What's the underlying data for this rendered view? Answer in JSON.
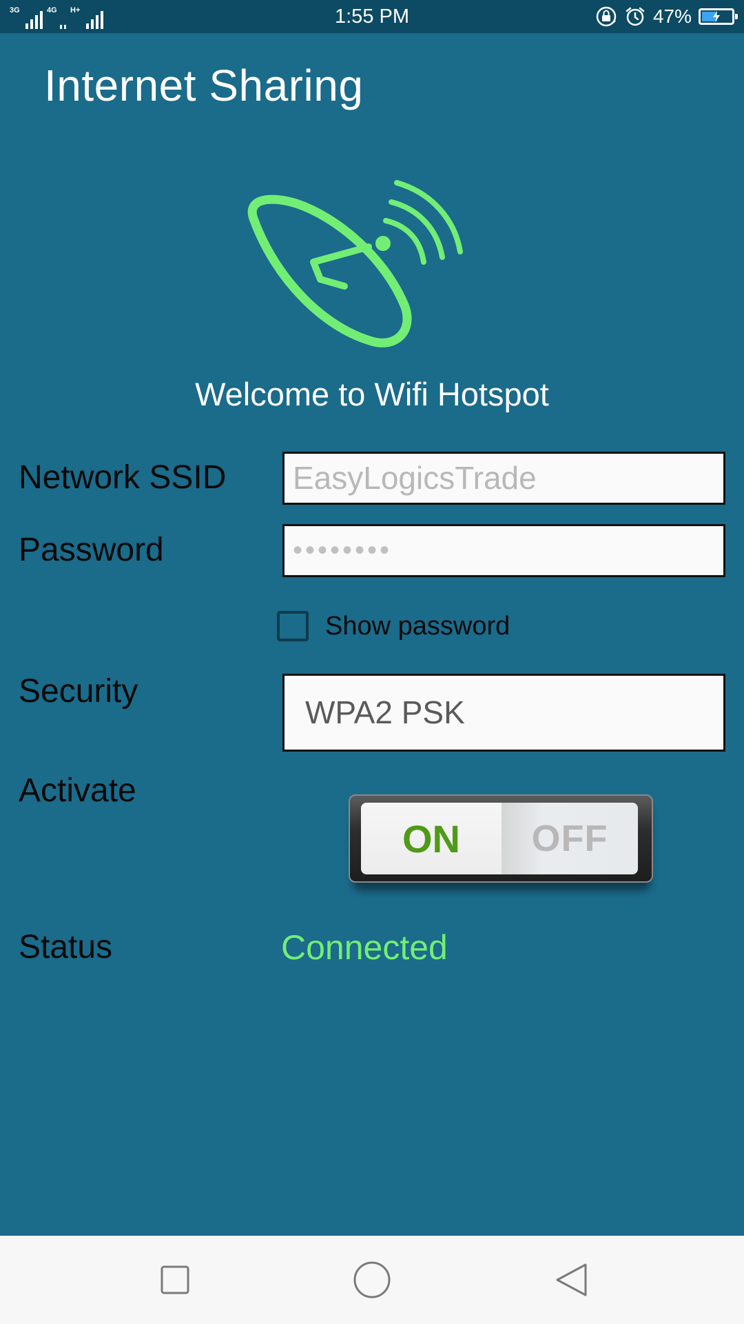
{
  "status_bar": {
    "network_1": "3G",
    "network_2": "4G",
    "network_3": "H+",
    "time": "1:55 PM",
    "battery_percent": "47%",
    "icons": [
      "rotation-lock-icon",
      "alarm-icon",
      "battery-charging-icon"
    ]
  },
  "app": {
    "title": "Internet Sharing",
    "logo_icon": "satellite-dish-icon",
    "welcome": "Welcome to Wifi Hotspot"
  },
  "form": {
    "ssid_label": "Network SSID",
    "ssid_placeholder": "EasyLogicsTrade",
    "password_label": "Password",
    "password_value": "••••••••",
    "show_password_label": "Show password",
    "show_password_checked": false,
    "security_label": "Security",
    "security_value": "WPA2 PSK",
    "activate_label": "Activate",
    "toggle_on_label": "ON",
    "toggle_off_label": "OFF",
    "toggle_state": "on",
    "status_label": "Status",
    "status_value": "Connected"
  },
  "nav": {
    "icons": [
      "recents-square-icon",
      "home-circle-icon",
      "back-triangle-icon"
    ]
  },
  "colors": {
    "background": "#1b6b8b",
    "status_bar": "#0d4a63",
    "accent_green": "#73ee75",
    "toggle_on_text": "#4f9a18"
  }
}
